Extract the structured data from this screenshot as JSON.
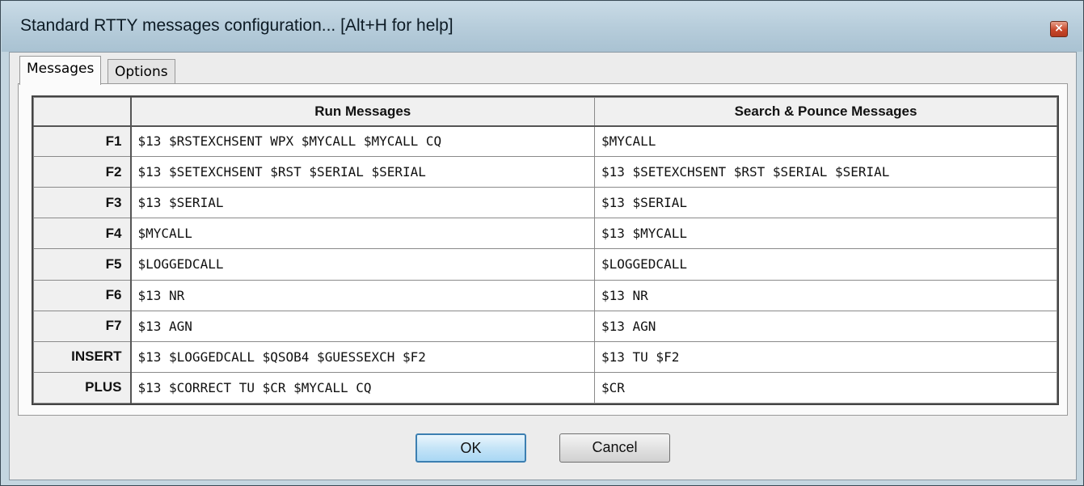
{
  "window": {
    "title": "Standard RTTY messages configuration... [Alt+H for help]",
    "close_glyph": "×"
  },
  "tabs": [
    {
      "label": "Messages",
      "active": true
    },
    {
      "label": "Options",
      "active": false
    }
  ],
  "grid": {
    "headers": [
      "Run Messages",
      "Search & Pounce Messages"
    ],
    "rows": [
      {
        "key": "F1",
        "run": "$13 $RSTEXCHSENT WPX $MYCALL $MYCALL CQ",
        "sp": "$MYCALL"
      },
      {
        "key": "F2",
        "run": "$13 $SETEXCHSENT $RST $SERIAL $SERIAL",
        "sp": "$13 $SETEXCHSENT $RST $SERIAL $SERIAL"
      },
      {
        "key": "F3",
        "run": "$13 $SERIAL",
        "sp": "$13 $SERIAL"
      },
      {
        "key": "F4",
        "run": "$MYCALL",
        "sp": "$13 $MYCALL"
      },
      {
        "key": "F5",
        "run": "$LOGGEDCALL",
        "sp": "$LOGGEDCALL"
      },
      {
        "key": "F6",
        "run": "$13 NR",
        "sp": "$13 NR"
      },
      {
        "key": "F7",
        "run": "$13 AGN",
        "sp": "$13 AGN"
      },
      {
        "key": "INSERT",
        "run": "$13 $LOGGEDCALL $QSOB4 $GUESSEXCH $F2",
        "sp": "$13 TU $F2"
      },
      {
        "key": "PLUS",
        "run": "$13 $CORRECT TU $CR $MYCALL CQ",
        "sp": "$CR"
      }
    ]
  },
  "buttons": {
    "ok_label": "OK",
    "cancel_label": "Cancel"
  },
  "colors": {
    "ok_button_border": "#3c7fb1",
    "close_button": "#c8472a"
  },
  "icons": {
    "close": "close-icon"
  }
}
